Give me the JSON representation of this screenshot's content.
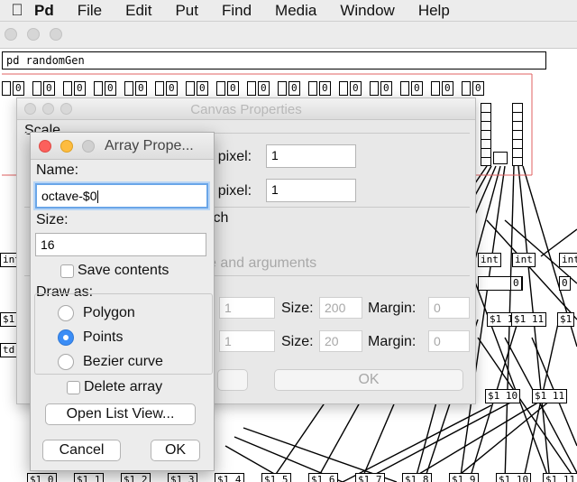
{
  "menubar": {
    "apple_icon": "apple-logo",
    "items": [
      "Pd",
      "File",
      "Edit",
      "Put",
      "Find",
      "Media",
      "Window",
      "Help"
    ]
  },
  "patch": {
    "subpatch_label": "pd randomGen",
    "toggle_values": [
      "0",
      "0",
      "0",
      "0",
      "0",
      "0",
      "0",
      "0",
      "0",
      "0",
      "0",
      "0",
      "0",
      "0",
      "0",
      "0"
    ],
    "int_label": "int",
    "msg_values": [
      "$1 10",
      "$1 11",
      "$1 10",
      "$1 11"
    ],
    "small_msg": "$1",
    "td_label": "td",
    "bottom_msgs": [
      "$1 0",
      "$1 1",
      "$1 2",
      "$1 3",
      "$1 4",
      "$1 5",
      "$1 6",
      "$1 7",
      "$1 8",
      "$1 9",
      "$1 10",
      "$1 11"
    ]
  },
  "canvas_dialog": {
    "title": "Canvas Properties",
    "scale_label": "Scale",
    "x_units_label": "r pixel:",
    "x_units_value": "1",
    "y_units_label": "r pixel:",
    "y_units_value": "1",
    "gop_label": "tch",
    "hide_label": "e and arguments",
    "x_size_label": "Size:",
    "x_size_value": "200",
    "x_margin_label": "Margin:",
    "x_margin_value": "0",
    "y_size_label": "Size:",
    "y_size_value": "20",
    "y_margin_label": "Margin:",
    "y_margin_value": "0",
    "x_range_value": "1",
    "y_range_value": "1",
    "ok_label": "OK"
  },
  "array_dialog": {
    "title": "Array Prope...",
    "name_label": "Name:",
    "name_value": "octave-$0",
    "size_label": "Size:",
    "size_value": "16",
    "save_contents_label": "Save contents",
    "draw_as_label": "Draw as:",
    "options": [
      "Polygon",
      "Points",
      "Bezier curve"
    ],
    "selected_option": "Points",
    "delete_array_label": "Delete array",
    "open_list_view_label": "Open List View...",
    "cancel_label": "Cancel",
    "ok_label": "OK"
  }
}
